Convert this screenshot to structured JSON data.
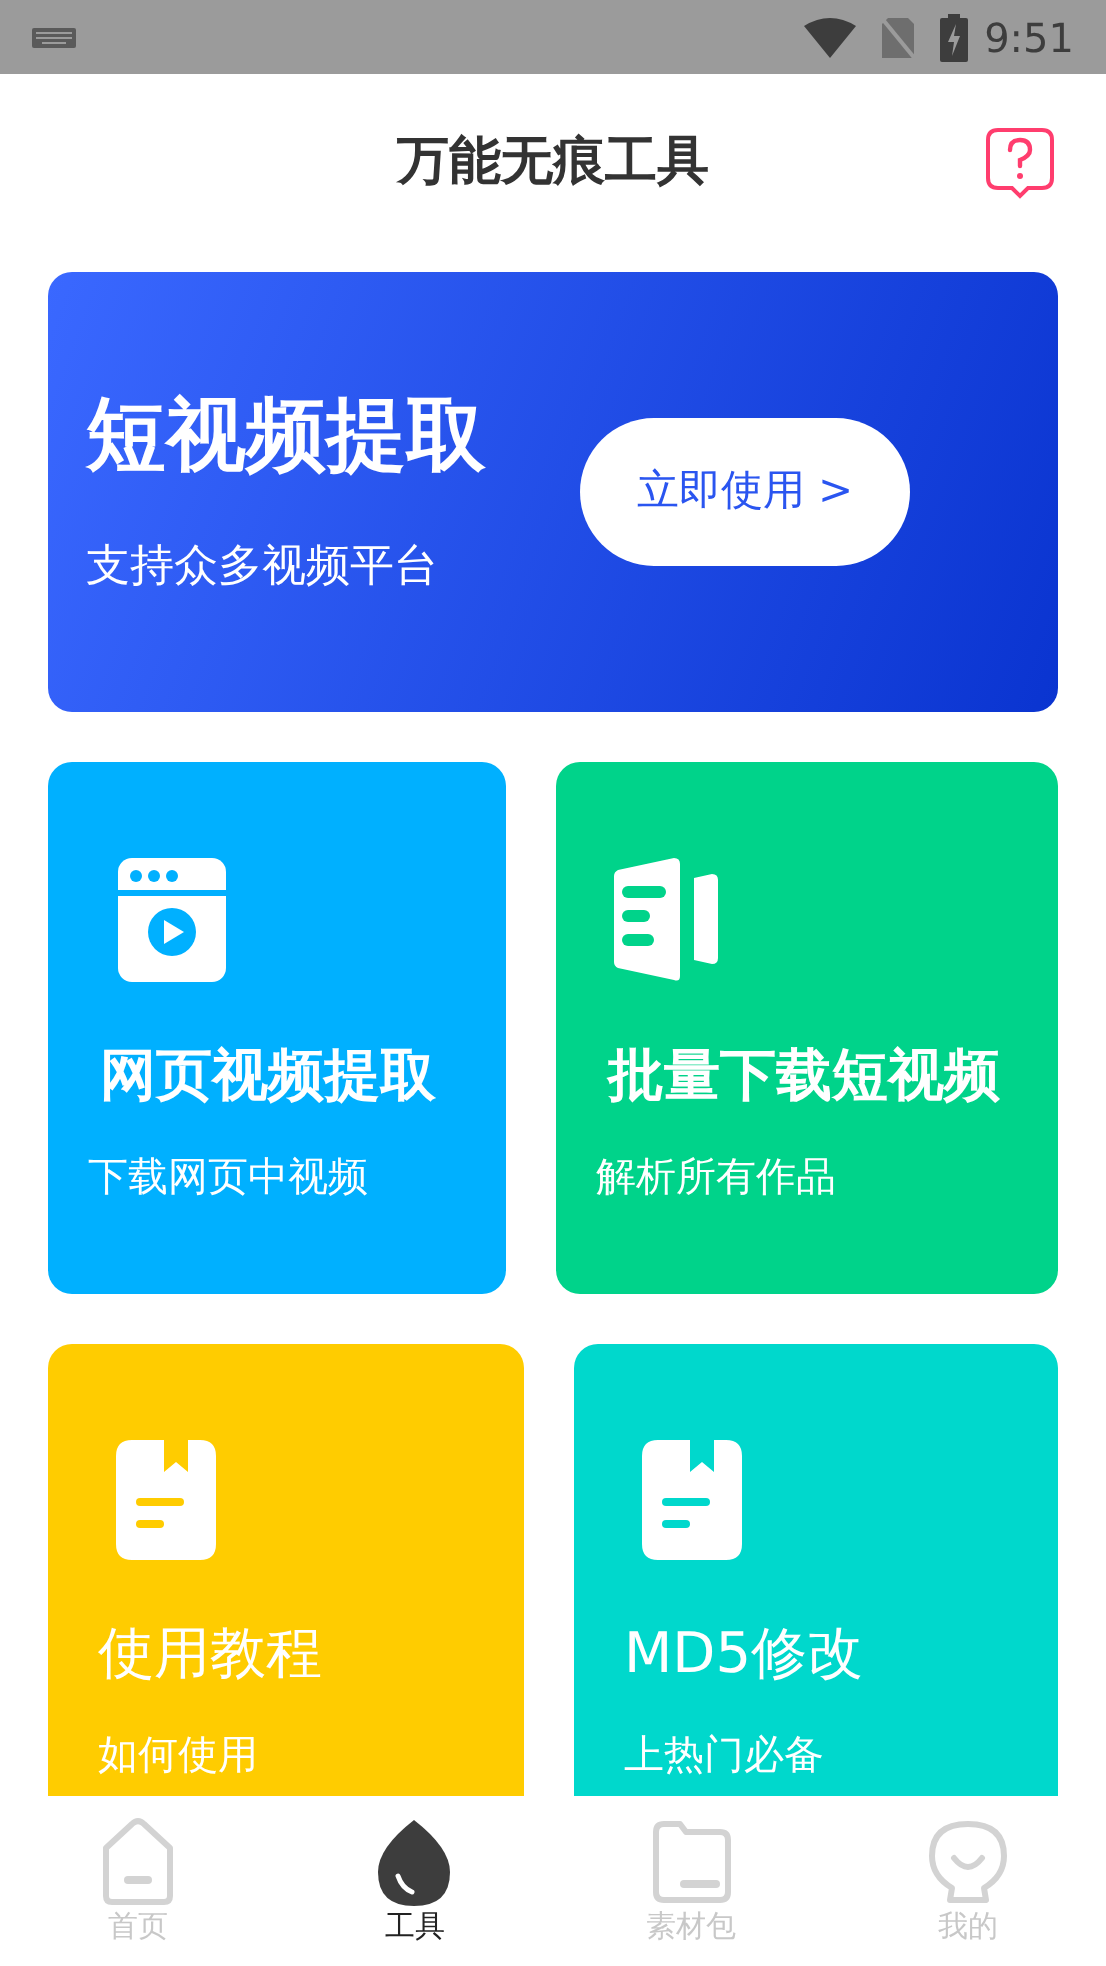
{
  "status_bar": {
    "time": "9:51"
  },
  "header": {
    "title": "万能无痕工具"
  },
  "banner": {
    "title": "短视频提取",
    "subtitle": "支持众多视频平台",
    "button": "立即使用 >"
  },
  "tools": [
    {
      "title": "网页视频提取",
      "subtitle": "下载网页中视频",
      "kind": "browser",
      "color": "#00b0ff"
    },
    {
      "title": "批量下载短视频",
      "subtitle": "解析所有作品",
      "kind": "clip",
      "color": "#00d38a"
    },
    {
      "title": "使用教程",
      "subtitle": "如何使用",
      "kind": "book",
      "color": "#ffcc00"
    },
    {
      "title": "MD5修改",
      "subtitle": "上热门必备",
      "kind": "book",
      "color": "#00d8cc"
    }
  ],
  "nav": [
    {
      "label": "首页",
      "kind": "home",
      "selected": false
    },
    {
      "label": "工具",
      "kind": "drop",
      "selected": true
    },
    {
      "label": "素材包",
      "kind": "folder",
      "selected": false
    },
    {
      "label": "我的",
      "kind": "face",
      "selected": false
    }
  ]
}
